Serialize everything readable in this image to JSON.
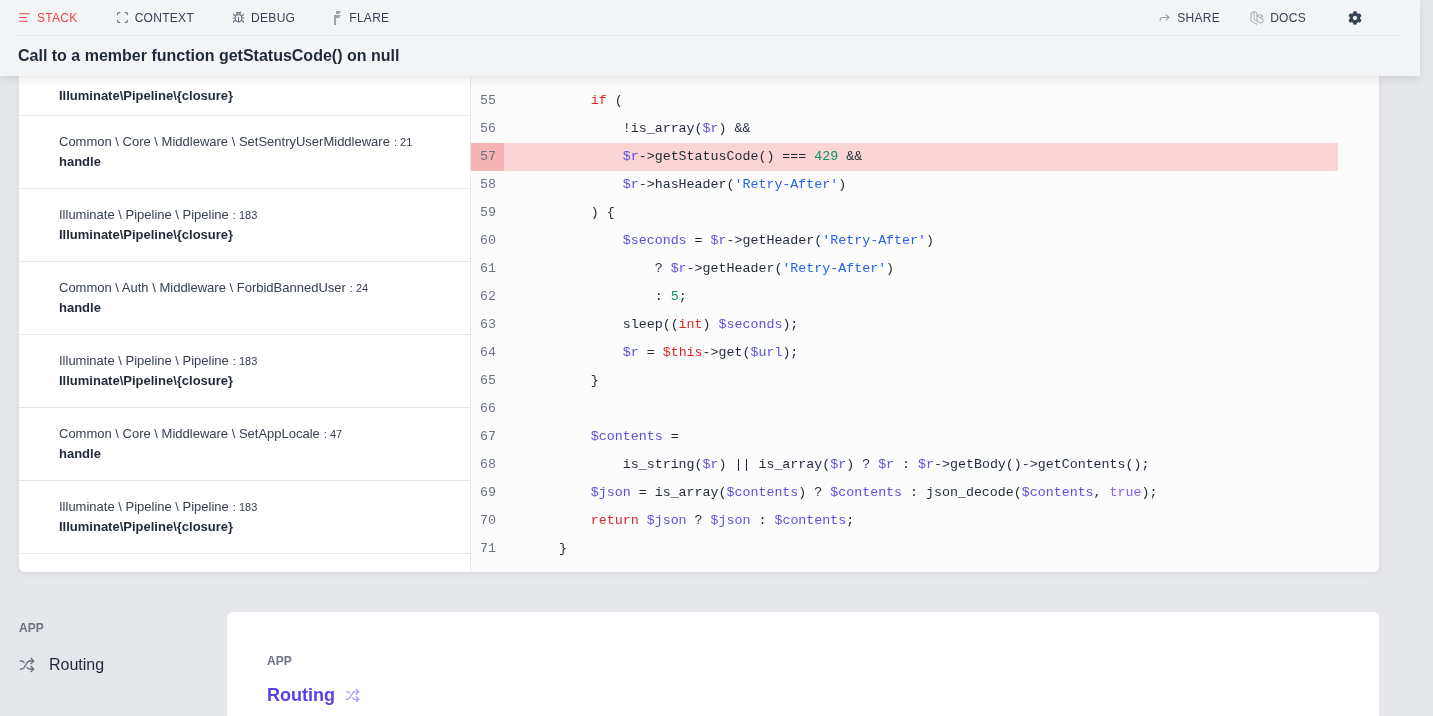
{
  "nav": {
    "tabs": [
      {
        "label": "STACK",
        "selected": true
      },
      {
        "label": "CONTEXT",
        "selected": false
      },
      {
        "label": "DEBUG",
        "selected": false
      },
      {
        "label": "FLARE",
        "selected": false
      }
    ],
    "links": [
      "SHARE",
      "DOCS"
    ]
  },
  "error_title": "Call to a member function getStatusCode() on null",
  "frames": [
    {
      "method": "Illuminate\\Pipeline\\{closure}"
    },
    {
      "file": "Common \\ Core \\ Middleware \\ SetSentryUserMiddleware",
      "line": ": 21",
      "method": "handle"
    },
    {
      "file": "Illuminate \\ Pipeline \\ Pipeline",
      "line": ": 183",
      "method": "Illuminate\\Pipeline\\{closure}"
    },
    {
      "file": "Common \\ Auth \\ Middleware \\ ForbidBannedUser",
      "line": ": 24",
      "method": "handle"
    },
    {
      "file": "Illuminate \\ Pipeline \\ Pipeline",
      "line": ": 183",
      "method": "Illuminate\\Pipeline\\{closure}"
    },
    {
      "file": "Common \\ Core \\ Middleware \\ SetAppLocale",
      "line": ": 47",
      "method": "handle"
    },
    {
      "file": "Illuminate \\ Pipeline \\ Pipeline",
      "line": ": 183",
      "method": "Illuminate\\Pipeline\\{closure}"
    }
  ],
  "code_lines": [
    {
      "number": "55",
      "highlighted": false,
      "tokens": [
        {
          "kind": "keyword",
          "text": "        if"
        },
        {
          "kind": "plain",
          "text": " ("
        }
      ]
    },
    {
      "number": "56",
      "highlighted": false,
      "tokens": [
        {
          "kind": "plain",
          "text": "            !is_array("
        },
        {
          "kind": "variable",
          "text": "$r"
        },
        {
          "kind": "plain",
          "text": ") &&"
        }
      ]
    },
    {
      "number": "57",
      "highlighted": true,
      "tokens": [
        {
          "kind": "variable",
          "text": "            $r"
        },
        {
          "kind": "plain",
          "text": "->getStatusCode() === "
        },
        {
          "kind": "number",
          "text": "429"
        },
        {
          "kind": "plain",
          "text": " &&"
        }
      ]
    },
    {
      "number": "58",
      "highlighted": false,
      "tokens": [
        {
          "kind": "variable",
          "text": "            $r"
        },
        {
          "kind": "plain",
          "text": "->hasHeader("
        },
        {
          "kind": "string",
          "text": "'Retry-After'"
        },
        {
          "kind": "plain",
          "text": ")"
        }
      ]
    },
    {
      "number": "59",
      "highlighted": false,
      "tokens": [
        {
          "kind": "plain",
          "text": "        ) {"
        }
      ]
    },
    {
      "number": "60",
      "highlighted": false,
      "tokens": [
        {
          "kind": "variable",
          "text": "            $seconds"
        },
        {
          "kind": "plain",
          "text": " = "
        },
        {
          "kind": "variable",
          "text": "$r"
        },
        {
          "kind": "plain",
          "text": "->getHeader("
        },
        {
          "kind": "string",
          "text": "'Retry-After'"
        },
        {
          "kind": "plain",
          "text": ")"
        }
      ]
    },
    {
      "number": "61",
      "highlighted": false,
      "tokens": [
        {
          "kind": "plain",
          "text": "                ? "
        },
        {
          "kind": "variable",
          "text": "$r"
        },
        {
          "kind": "plain",
          "text": "->getHeader("
        },
        {
          "kind": "string",
          "text": "'Retry-After'"
        },
        {
          "kind": "plain",
          "text": ")"
        }
      ]
    },
    {
      "number": "62",
      "highlighted": false,
      "tokens": [
        {
          "kind": "plain",
          "text": "                : "
        },
        {
          "kind": "number",
          "text": "5"
        },
        {
          "kind": "plain",
          "text": ";"
        }
      ]
    },
    {
      "number": "63",
      "highlighted": false,
      "tokens": [
        {
          "kind": "plain",
          "text": "            sleep(("
        },
        {
          "kind": "keyword",
          "text": "int"
        },
        {
          "kind": "plain",
          "text": ") "
        },
        {
          "kind": "variable",
          "text": "$seconds"
        },
        {
          "kind": "plain",
          "text": ");"
        }
      ]
    },
    {
      "number": "64",
      "highlighted": false,
      "tokens": [
        {
          "kind": "variable",
          "text": "            $r"
        },
        {
          "kind": "plain",
          "text": " = "
        },
        {
          "kind": "keyword",
          "text": "$this"
        },
        {
          "kind": "plain",
          "text": "->get("
        },
        {
          "kind": "variable",
          "text": "$url"
        },
        {
          "kind": "plain",
          "text": ");"
        }
      ]
    },
    {
      "number": "65",
      "highlighted": false,
      "tokens": [
        {
          "kind": "plain",
          "text": "        }"
        }
      ]
    },
    {
      "number": "66",
      "highlighted": false
    },
    {
      "number": "67",
      "highlighted": false,
      "tokens": [
        {
          "kind": "variable",
          "text": "        $contents"
        },
        {
          "kind": "plain",
          "text": " ="
        }
      ]
    },
    {
      "number": "68",
      "highlighted": false,
      "tokens": [
        {
          "kind": "plain",
          "text": "            is_string("
        },
        {
          "kind": "variable",
          "text": "$r"
        },
        {
          "kind": "plain",
          "text": ") || is_array("
        },
        {
          "kind": "variable",
          "text": "$r"
        },
        {
          "kind": "plain",
          "text": ") ? "
        },
        {
          "kind": "variable",
          "text": "$r"
        },
        {
          "kind": "plain",
          "text": " : "
        },
        {
          "kind": "variable",
          "text": "$r"
        },
        {
          "kind": "plain",
          "text": "->getBody()->getContents();"
        }
      ]
    },
    {
      "number": "69",
      "highlighted": false,
      "tokens": [
        {
          "kind": "variable",
          "text": "        $json"
        },
        {
          "kind": "plain",
          "text": " = is_array("
        },
        {
          "kind": "variable",
          "text": "$contents"
        },
        {
          "kind": "plain",
          "text": ") ? "
        },
        {
          "kind": "variable",
          "text": "$contents"
        },
        {
          "kind": "plain",
          "text": " : json_decode("
        },
        {
          "kind": "variable",
          "text": "$contents"
        },
        {
          "kind": "plain",
          "text": ", "
        },
        {
          "kind": "constant",
          "text": "true"
        },
        {
          "kind": "plain",
          "text": ");"
        }
      ]
    },
    {
      "number": "70",
      "highlighted": false,
      "tokens": [
        {
          "kind": "keyword",
          "text": "        return"
        },
        {
          "kind": "variable",
          "text": " $json"
        },
        {
          "kind": "plain",
          "text": " ? "
        },
        {
          "kind": "variable",
          "text": "$json"
        },
        {
          "kind": "plain",
          "text": " : "
        },
        {
          "kind": "variable",
          "text": "$contents"
        },
        {
          "kind": "plain",
          "text": ";"
        }
      ]
    },
    {
      "number": "71",
      "highlighted": false,
      "tokens": [
        {
          "kind": "plain",
          "text": "    }"
        }
      ]
    }
  ],
  "sidebar": {
    "section": "APP",
    "items": [
      "Routing"
    ]
  },
  "section_card": {
    "label": "APP",
    "title": "Routing"
  }
}
